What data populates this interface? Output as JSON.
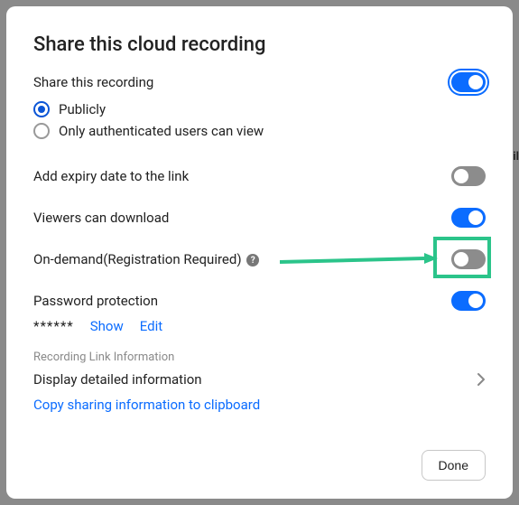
{
  "title": "Share this cloud recording",
  "share": {
    "label": "Share this recording",
    "options": {
      "publicly": "Publicly",
      "authOnly": "Only authenticated users can view"
    }
  },
  "rows": {
    "expiry": "Add expiry date to the link",
    "download": "Viewers can download",
    "ondemand": "On-demand(Registration Required)",
    "password": "Password protection"
  },
  "pw": {
    "mask": "******",
    "show": "Show",
    "edit": "Edit"
  },
  "section": {
    "heading": "Recording Link Information",
    "detail": "Display detailed information",
    "copy": "Copy sharing information to clipboard"
  },
  "footer": {
    "done": "Done"
  },
  "bgText": "il",
  "helpGlyph": "?"
}
